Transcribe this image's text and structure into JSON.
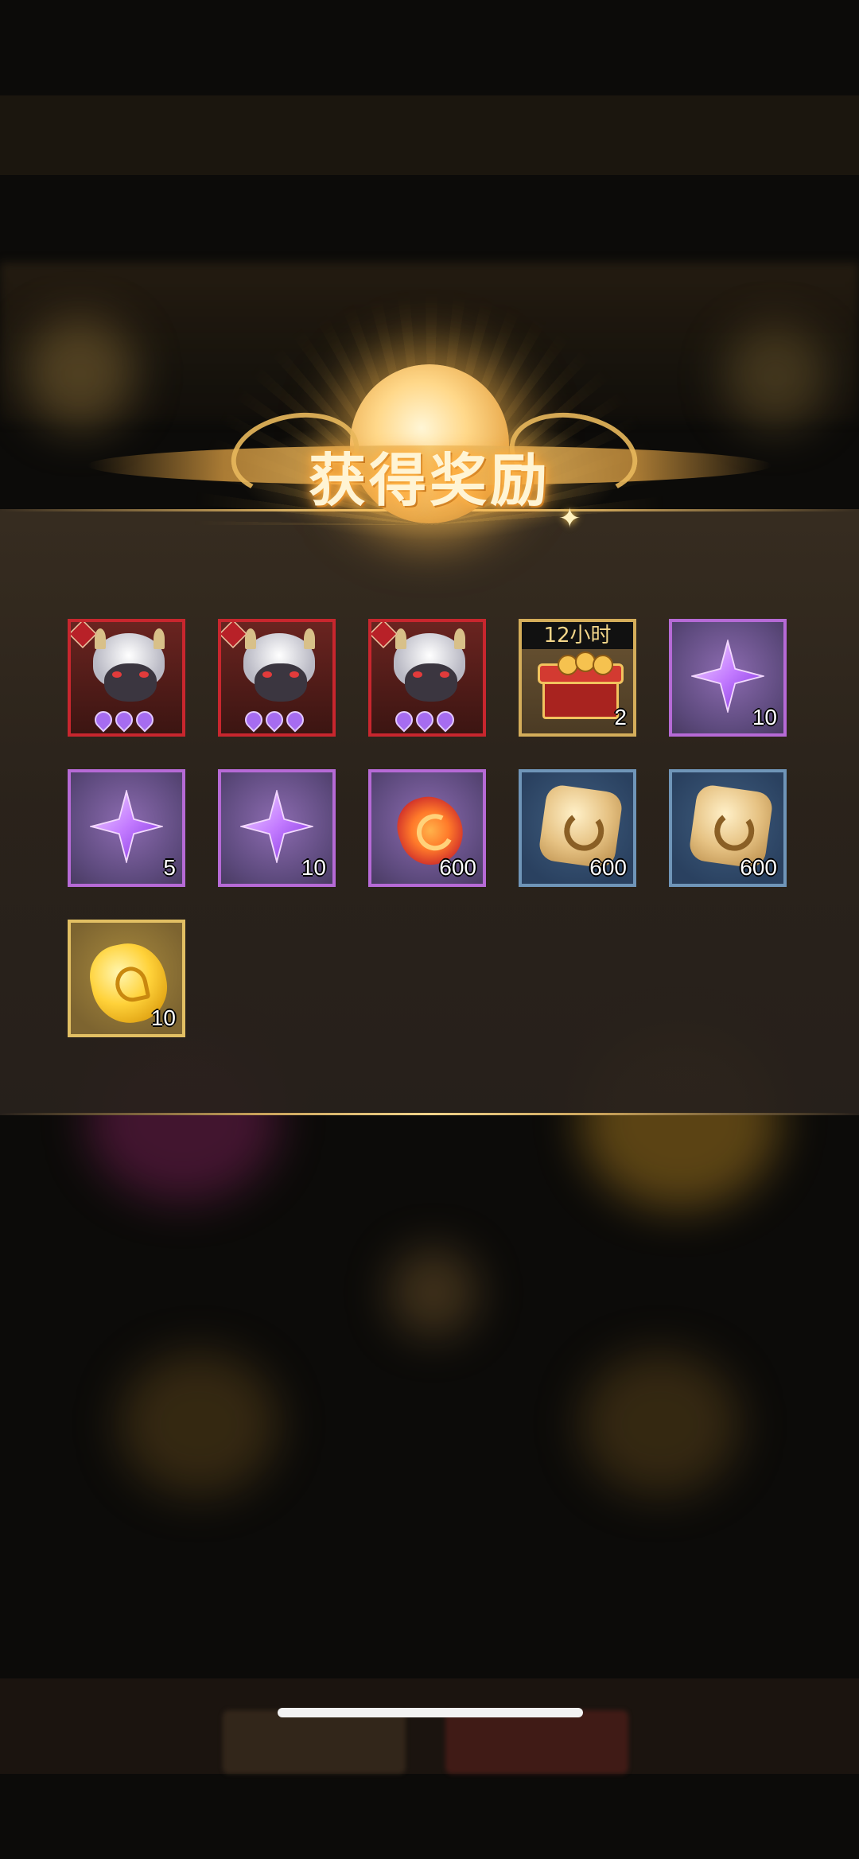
{
  "header": {
    "title": "获得奖励"
  },
  "rewards": [
    {
      "type": "hero",
      "frame": "red",
      "quantity": "",
      "icon": "hero-portrait-icon"
    },
    {
      "type": "hero",
      "frame": "red",
      "quantity": "",
      "icon": "hero-portrait-icon"
    },
    {
      "type": "hero",
      "frame": "red",
      "quantity": "",
      "icon": "hero-portrait-icon"
    },
    {
      "type": "chest",
      "frame": "gold",
      "quantity": "2",
      "time_label": "12小时",
      "icon": "red-chest-icon"
    },
    {
      "type": "star-gem",
      "frame": "purple",
      "quantity": "10",
      "icon": "purple-star-icon"
    },
    {
      "type": "star-gem",
      "frame": "purple",
      "quantity": "5",
      "icon": "purple-star-icon"
    },
    {
      "type": "star-gem",
      "frame": "purple",
      "quantity": "10",
      "icon": "purple-star-icon"
    },
    {
      "type": "swirl-token",
      "frame": "purple",
      "quantity": "600",
      "icon": "red-swirl-token-icon"
    },
    {
      "type": "dragon-coin",
      "frame": "blue",
      "quantity": "600",
      "icon": "dragon-coin-icon"
    },
    {
      "type": "dragon-coin",
      "frame": "blue",
      "quantity": "600",
      "icon": "dragon-coin-icon"
    },
    {
      "type": "gold-coin",
      "frame": "goldbright",
      "quantity": "10",
      "icon": "gold-coin-icon"
    }
  ],
  "colors": {
    "frame_red": "#c8262e",
    "frame_gold": "#d4ad5a",
    "frame_purple": "#b66ad6",
    "frame_blue": "#6f95b8",
    "title_glow": "#ffb84a"
  }
}
